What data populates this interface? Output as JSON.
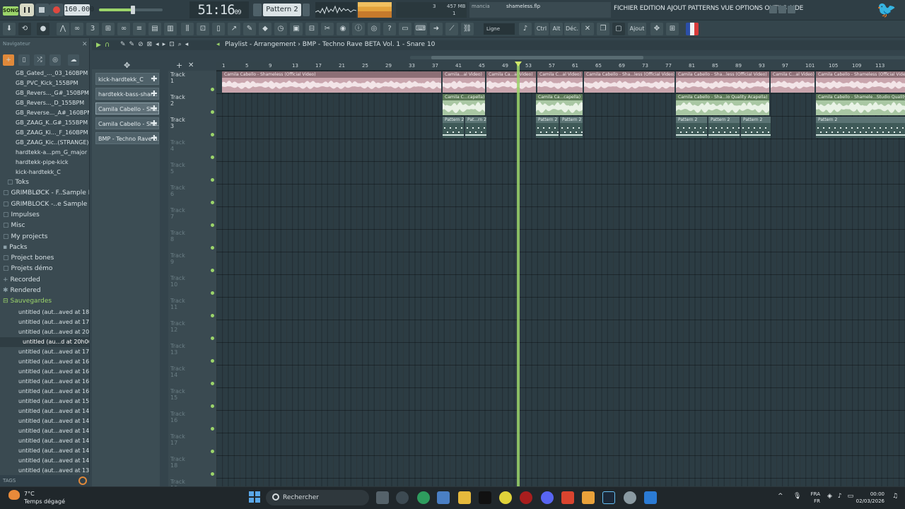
{
  "transport": {
    "mode_label": "SONG",
    "tempo": "160.000",
    "time_main": "51:16",
    "time_sub": "09",
    "pattern": "Pattern 2",
    "cpu_line1": "3",
    "mem_line1": "457 MB",
    "mem_line2": "1",
    "hint_user": "mancia",
    "hint_file": "shameless.flp"
  },
  "menu": "FICHIER EDITION AJOUT PATTERNS VUE OPTIONS OUTILS AIDE",
  "toolbar": {
    "snap_label": "Ligne",
    "ctrl_label": "Ctrl",
    "alt_label": "Alt",
    "dec_label": "Déc.",
    "ajout_label": "Ajout"
  },
  "browser": {
    "title": "Navigateur",
    "files_top": [
      "GB_Gated_..._03_160BPM",
      "GB_PVC_Kick_155BPM",
      "GB_Revers..._G#_150BPM",
      "GB_Revers..._D_155BPM",
      "GB_Reverse..._A#_160BPM",
      "GB_ZAAG_K..G#_155BPM",
      "GB_ZAAG_Ki..._F_160BPM",
      "GB_ZAAG_Kic..(STRANGE)",
      "hardtekk-a...pm_G_major",
      "hardtekk-pipe-kick",
      "kick-hardtekk_C"
    ],
    "folders": [
      "Toks",
      "GRIMBLØCK - F..Sample Pack",
      "GRIMBLOCK -..e Sample Pack",
      "Impulses",
      "Misc",
      "My projects",
      "Packs",
      "Project bones",
      "Projets démo",
      "Recorded",
      "Rendered",
      "Sauvegardes"
    ],
    "saves": [
      "untitled (aut...aved at 18h20)",
      "untitled (aut...aved at 17h50)",
      "untitled (aut...aved at 20h27)",
      "untitled (au...d at 20h06)_2",
      "untitled (aut...aved at 17h09)",
      "untitled (aut...aved at 16h59)",
      "untitled (aut...aved at 16h49)",
      "untitled (aut...aved at 16h41)",
      "untitled (aut...aved at 16h29)",
      "untitled (aut...aved at 15h05)",
      "untitled (aut...aved at 14h53)",
      "untitled (aut...aved at 14h43)",
      "untitled (aut...aved at 14h33)",
      "untitled (aut...aved at 14h12)",
      "untitled (aut...aved at 14h01)",
      "untitled (aut...aved at 14h06)",
      "untitled (aut...aved at 13h54)"
    ],
    "tags_label": "TAGS"
  },
  "picker": [
    "kick-hardtekk_C",
    "hardtekk-bass-shar...",
    "Camila Cabello - Sha...",
    "Camila Cabello - Sha...",
    "BMP - Techno Rave B..."
  ],
  "playlist": {
    "title": "Playlist - Arrangement",
    "breadcrumb": "BMP - Techno Rave BETA Vol. 1 - Snare 10",
    "bars": [
      "1",
      "5",
      "9",
      "13",
      "17",
      "21",
      "25",
      "29",
      "33",
      "37",
      "41",
      "45",
      "49",
      "53",
      "57",
      "61",
      "65",
      "69",
      "73",
      "77",
      "81",
      "85",
      "89",
      "93",
      "97",
      "101",
      "105",
      "109",
      "113"
    ],
    "tracks": [
      "Track 1",
      "Track 2",
      "Track 3",
      "Track 4",
      "Track 5",
      "Track 6",
      "Track 7",
      "Track 8",
      "Track 9",
      "Track 10",
      "Track 11",
      "Track 12",
      "Track 13",
      "Track 14",
      "Track 15",
      "Track 16",
      "Track 17",
      "Track 18",
      "Track 19"
    ],
    "clips_track1": [
      "Camila Cabello - Shameless (Official Video)",
      "Camila...al Video)",
      "Camila Ca...al Video)",
      "Camila C...al Video)",
      "Camila Cabello - Sha...less (Official Video)",
      "Camila Cabello - Sha...less (Official Video)",
      "Camila C...al Video)",
      "Camila Cabello - Shameless (Official Video)"
    ],
    "clips_track2": [
      "Camila C...capella)",
      "Camila Ca...capella)",
      "Camila Cabello - Sha...io Quality Acapella)",
      "Camila Cabello - Shamele...Studio Quality Acap"
    ],
    "clips_track3": [
      "Pattern 2",
      "Pat...rn 2",
      "Pattern 2",
      "Pattern 2",
      "Pattern 2",
      "Pattern 2",
      "Pattern 2",
      "Pattern 2"
    ]
  },
  "taskbar": {
    "temp": "7°C",
    "weather": "Temps dégagé",
    "search_placeholder": "Rechercher",
    "lang1": "FRA",
    "lang2": "FR",
    "time": "00:00",
    "date": "02/03/2026"
  },
  "colors": {
    "accent_green": "#9bd46a",
    "audio_clip": "#c9a5ad",
    "acapella_clip": "#a9c7a3"
  }
}
